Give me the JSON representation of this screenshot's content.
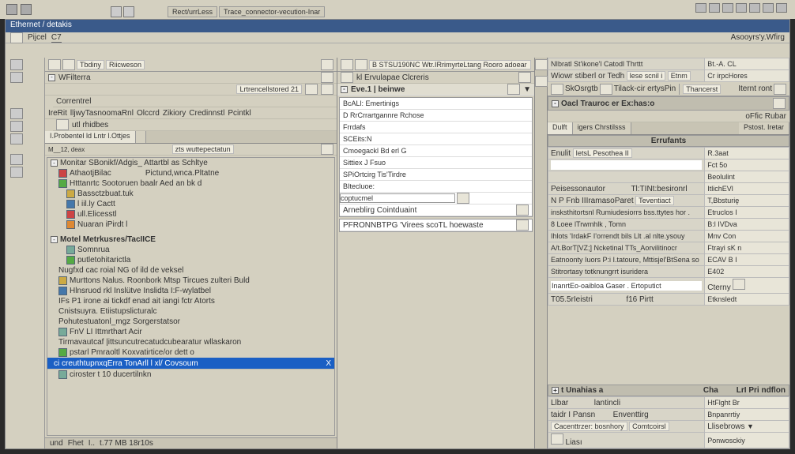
{
  "top": {
    "tab1": "Rect/urrLess",
    "tab2": "Trace_connector-vecution-Inar"
  },
  "title": "Ethernet / detakis",
  "subbar": {
    "a": "Pijcel",
    "b": "C7"
  },
  "toolbar": {
    "a": "Tbdiny",
    "b": "Riicweson"
  },
  "fileTab": "WFilterra",
  "crumb": "Lrtrencellstored 21",
  "crumb2": "Correntrel",
  "menu": {
    "a": "IreRit",
    "b": "lljwyTasnoomaRnl",
    "c": "Olccrd",
    "d": "Zikiory",
    "e": "Credinnstl",
    "f": "Pcintkl"
  },
  "filter": "utl rhidbes",
  "probe": {
    "tab1": "I.Probentel ld Lntr l.Ottjes",
    "tab2": "",
    "search": "zts wuttepectatun"
  },
  "tree": {
    "root": "Monitar SBonikf/Adgis_ Attartbl as Schltye",
    "a": "AthaotjBilac",
    "a2": "Pictund,wnca.Pltatne",
    "b": "Htttanrtc Sootoruen baalr  Aed  an  bk  d",
    "c": "Bassctzbuat.tuk",
    "d": "l iil.ly Cactt",
    "e": "ull.Elicesstl",
    "f": "Nuaran iPirdt l",
    "sec2": "Motel  Metrkusres/TacIICE",
    "g": "Somnrua",
    "h": "putletohitarictla",
    "i": "Nugfxd cac roial NG of ild de veksel",
    "j": "Murttons Nalus. Roonbork  Mtsp  Tircues zulteri  Buld",
    "k": "Hlnsruod rkl Inslütve Inslidta I:F-wylatbel",
    "l": "IFs P1 irone ai tickdf enad ait iangi fctr Atorts",
    "m": "Cnistsuyra. Etiistupslicturalc",
    "n": "Pohutestuatonl_mgz Sorgerstatsor",
    "o": "FnV LI Ittmrthart  Acir",
    "p": "Tirmavautcaf |ittsuncutrecatudcubearatur wllaskaron",
    "q": "pstarl Pmraoltl   Koxvatirtice/or dett o",
    "sel": "ci creuthtupnxqErra TonArll l xl/ Covsoum",
    "r": "ciroster t 10  ducertilnkn"
  },
  "status": {
    "a": "und",
    "b": "Fhet",
    "c": "t.77 MB 18r10s"
  },
  "mid": {
    "hdr": "B STSU190NC  Wtr.IRrimyrteLtang Rooro adoear",
    "sub": "kl Ervulapae Clcreris",
    "eve": "Eve.1 | beinwe",
    "items": [
      "BcALl: Emertinigs",
      "D RrCrrartgannre Rchose",
      "Frrdafs",
      "SCEits:N",
      "Cmoegackl Bd erl G",
      "Sittiex J  Fsuo",
      "SPiOrtcirg Tis'Tirdre",
      "BItecluoe:",
      "coptucmel",
      "Arneblirg Cointduaint",
      "PFRONNBTPG 'Virees scoTL hoewaste"
    ],
    "input": ""
  },
  "right": {
    "hdr1": "NIbratl St'ikone'l Catodl Thrttt",
    "hdr1v": "Bt.-A. CL",
    "hdr2": "Wiowr stiberl or Tedh",
    "hdr2a": "lese scnil i",
    "hdr2b": "Etnm",
    "hdr2c": "Cr irpcHores",
    "tb": {
      "a": "SkOsrgtb",
      "b": "Tilack-cir ertysPin",
      "c": "Thancerst",
      "d": "Iternt ront"
    },
    "sec1": "Oacl Trauroc er Ex:has:o",
    "tabs": {
      "a": "Dulft",
      "b": "igers Chrstilsss",
      "c": "Pstost. Iretar"
    },
    "sec2": "Errufants",
    "rows": [
      {
        "k": "Enulit",
        "k2": "IetsL Pesothea II",
        "v": "R.3aat"
      },
      {
        "k": "",
        "k2": "",
        "v": "Fct 5o",
        "input": true
      },
      {
        "k": "",
        "k2": "",
        "v": "Beolulint"
      },
      {
        "k": "Peisessonautor",
        "k2": "Tl:TINt:besironrl",
        "v": "ItlichEVl"
      },
      {
        "k": "N P Fnb",
        "k2": "IIIramasoParet",
        "k3": "Teventiact",
        "v": "T,Bbsturię"
      },
      {
        "k": "insksthitortsnl Rumiudesiorrs bss.ttytes hor .",
        "v": "Etruclos I"
      },
      {
        "k": "8 Loee lTrwmhlk , Tomn",
        "v": "B:l IVDva"
      },
      {
        "k": "Ihlots 'IrdakF I'orrendt bils Llt .al nlte.ysouy",
        "v": "Mnv Con"
      },
      {
        "k": "A/t.BorT[VZ;]  Ncketinal TTs_Aorvilitinocr",
        "v": "Ftrayi sK n"
      },
      {
        "k": "Eatnoonty Iuors P:i  I.tatoure,  Mttisjel'BtSena so",
        "v": "ECAV  B I"
      },
      {
        "k": "Stitrortasy totknungrrt isuridera",
        "v": "E402"
      },
      {
        "k": "InanrtEo-oaibloa Gaser . Ertoputict",
        "v": "Cterny",
        "input": true
      },
      {
        "k": "T05.5rIeistri",
        "k2": "f16 Pirtt",
        "v": "Etknsledt"
      }
    ],
    "sec3": {
      "hdr": "t Unahias a",
      "a": "Cha",
      "b": "LrI Pri ndflon"
    },
    "sec4": {
      "a": "Llbar",
      "b": "lantincli",
      "c": "HtFlght Br"
    },
    "sec5": {
      "a": "taidr I Pansn",
      "b": "Enventtirg",
      "c": "Bnpanrrtiy"
    },
    "sec6": {
      "a": "Cacenttrzer: bosnhory",
      "b": "Comtcoirsl",
      "c": "Llisebrows"
    },
    "sec7": {
      "a": "Liası",
      "v": "Ponwosckiy"
    }
  },
  "sysMenu": "Asooyrs'y.Wfirg"
}
